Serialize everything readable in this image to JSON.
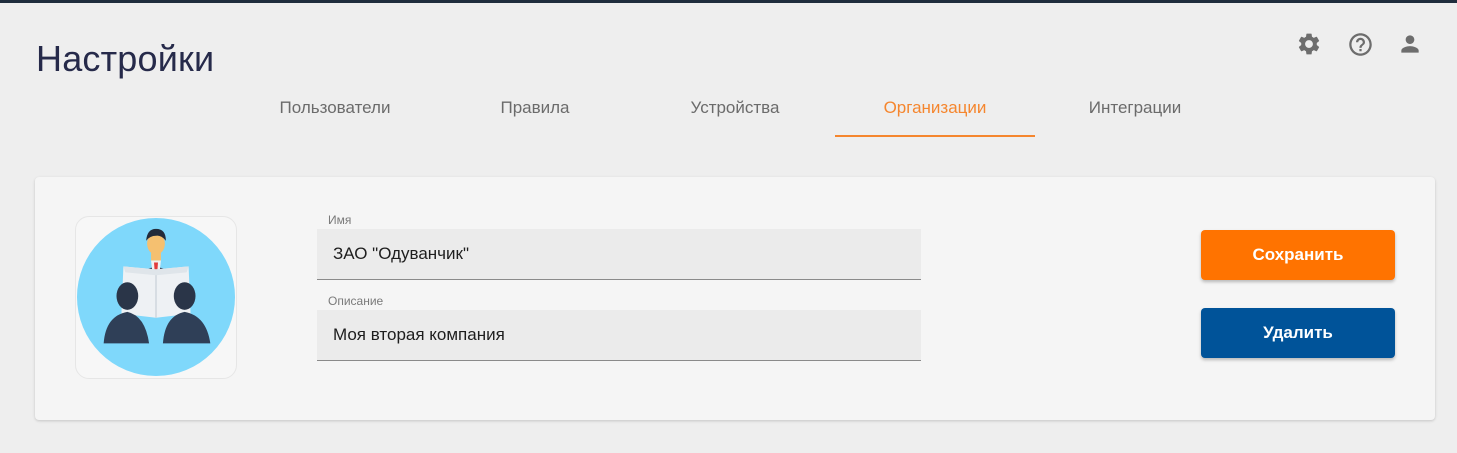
{
  "page": {
    "title": "Настройки"
  },
  "header_icons": [
    {
      "icon": "gear-icon",
      "label": "settings"
    },
    {
      "icon": "help-circle-icon",
      "label": "help"
    },
    {
      "icon": "user-icon",
      "label": "account"
    }
  ],
  "tabs": [
    {
      "label": "Пользователи",
      "active": false
    },
    {
      "label": "Правила",
      "active": false
    },
    {
      "label": "Устройства",
      "active": false
    },
    {
      "label": "Организации",
      "active": true
    },
    {
      "label": "Интеграции",
      "active": false
    }
  ],
  "organization": {
    "avatar_icon": "business-people-icon",
    "name_label": "Имя",
    "name_value": "ЗАО \"Одуванчик\"",
    "description_label": "Описание",
    "description_value": "Моя вторая компания"
  },
  "actions": {
    "save_label": "Сохранить",
    "delete_label": "Удалить"
  },
  "colors": {
    "accent_orange": "#ff7300",
    "tab_active": "#f5862e",
    "delete_blue": "#005399",
    "title": "#262a4a"
  }
}
